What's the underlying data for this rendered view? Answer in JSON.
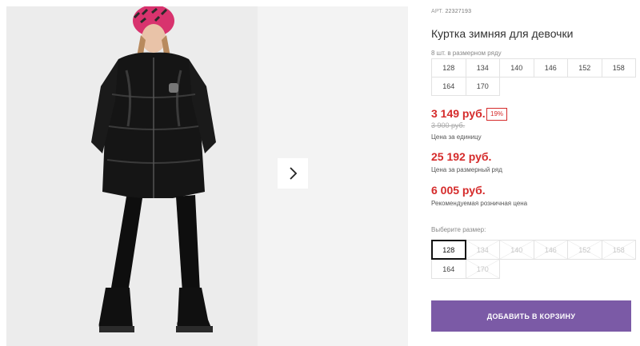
{
  "product": {
    "article_label": "АРТ.",
    "article_value": "22327193",
    "title": "Куртка зимняя для девочки"
  },
  "pack": {
    "label": "8 шт. в размерном ряду",
    "sizes": [
      "128",
      "134",
      "140",
      "146",
      "152",
      "158",
      "164",
      "170"
    ]
  },
  "prices": {
    "unit_price": "3 149 руб.",
    "discount_badge": "19%",
    "old_price": "3 900 руб.",
    "unit_caption": "Цена за единицу",
    "row_price": "25 192 руб.",
    "row_caption": "Цена за размерный ряд",
    "rrp_price": "6 005 руб.",
    "rrp_caption": "Рекомендуемая розничная цена"
  },
  "size_picker": {
    "label": "Выберите размер:",
    "selected": "128",
    "options": [
      {
        "label": "128",
        "state": "selected"
      },
      {
        "label": "134",
        "state": "disabled"
      },
      {
        "label": "140",
        "state": "disabled"
      },
      {
        "label": "146",
        "state": "disabled"
      },
      {
        "label": "152",
        "state": "disabled"
      },
      {
        "label": "158",
        "state": "disabled"
      },
      {
        "label": "164",
        "state": "available"
      },
      {
        "label": "170",
        "state": "disabled"
      }
    ]
  },
  "actions": {
    "add_to_cart": "ДОБАВИТЬ В КОРЗИНУ"
  },
  "gallery": {
    "next_icon": "chevron-right-icon"
  },
  "colors": {
    "accent": "#7b5aa6",
    "price": "#d52b2b"
  }
}
